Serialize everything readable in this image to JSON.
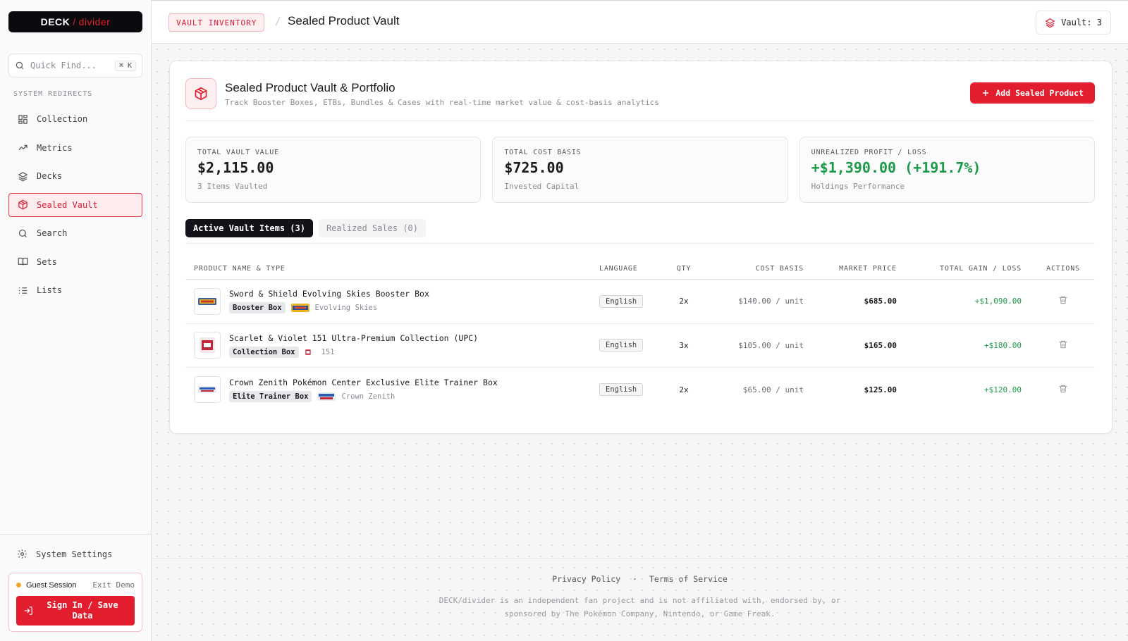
{
  "app": {
    "logo": {
      "brand": "DECK",
      "slash": "/",
      "accent": "divider"
    },
    "accent_color": "#e11d2e"
  },
  "sidebar": {
    "search": {
      "placeholder": "Quick Find...",
      "shortcut": "⌘ K"
    },
    "section_label": "SYSTEM REDIRECTS",
    "items": [
      {
        "label": "Collection",
        "icon": "grid-icon",
        "active": false
      },
      {
        "label": "Metrics",
        "icon": "trend-icon",
        "active": false
      },
      {
        "label": "Decks",
        "icon": "layers-icon",
        "active": false
      },
      {
        "label": "Sealed Vault",
        "icon": "box-icon",
        "active": true
      },
      {
        "label": "Search",
        "icon": "search-icon",
        "active": false
      },
      {
        "label": "Sets",
        "icon": "book-icon",
        "active": false
      },
      {
        "label": "Lists",
        "icon": "list-icon",
        "active": false
      }
    ],
    "settings_label": "System Settings",
    "guest": {
      "label": "Guest Session",
      "exit": "Exit Demo",
      "signin_line1": "Sign In / Save",
      "signin_line2": "Data"
    }
  },
  "topbar": {
    "breadcrumb_tag": "VAULT INVENTORY",
    "separator": "/",
    "title": "Sealed Product Vault",
    "vault_count": "Vault: 3"
  },
  "card": {
    "title": "Sealed Product Vault & Portfolio",
    "subtitle": "Track Booster Boxes, ETBs, Bundles & Cases with real-time market value & cost-basis analytics",
    "add_button": "Add Sealed Product"
  },
  "stats": [
    {
      "label": "TOTAL VAULT VALUE",
      "value": "$2,115.00",
      "sub": "3 Items Vaulted",
      "positive": false
    },
    {
      "label": "TOTAL COST BASIS",
      "value": "$725.00",
      "sub": "Invested Capital",
      "positive": false
    },
    {
      "label": "UNREALIZED PROFIT / LOSS",
      "value": "+$1,390.00 (+191.7%)",
      "sub": "Holdings Performance",
      "positive": true
    }
  ],
  "tabs": [
    {
      "label": "Active Vault Items (3)",
      "active": true
    },
    {
      "label": "Realized Sales (0)",
      "active": false
    }
  ],
  "table": {
    "headers": {
      "product": "PRODUCT NAME & TYPE",
      "language": "LANGUAGE",
      "qty": "QTY",
      "cost": "COST BASIS",
      "market": "MARKET PRICE",
      "gain": "TOTAL GAIN / LOSS",
      "actions": "ACTIONS"
    },
    "rows": [
      {
        "name": "Sword & Shield Evolving Skies Booster Box",
        "type": "Booster Box",
        "set": "Evolving Skies",
        "language": "English",
        "qty": "2x",
        "cost": "$140.00 / unit",
        "market": "$685.00",
        "gain": "+$1,090.00"
      },
      {
        "name": "Scarlet & Violet 151 Ultra-Premium Collection (UPC)",
        "type": "Collection Box",
        "set": "151",
        "language": "English",
        "qty": "3x",
        "cost": "$105.00 / unit",
        "market": "$165.00",
        "gain": "+$180.00"
      },
      {
        "name": "Crown Zenith Pokémon Center Exclusive Elite Trainer Box",
        "type": "Elite Trainer Box",
        "set": "Crown Zenith",
        "language": "English",
        "qty": "2x",
        "cost": "$65.00 / unit",
        "market": "$125.00",
        "gain": "+$120.00"
      }
    ]
  },
  "footer": {
    "privacy": "Privacy Policy",
    "separator": "·",
    "terms": "Terms of Service",
    "disclaimer_line1": "DECK/divider is an independent fan project and is not affiliated with, endorsed by, or",
    "disclaimer_line2": "sponsored by The Pokémon Company, Nintendo, or Game Freak."
  }
}
